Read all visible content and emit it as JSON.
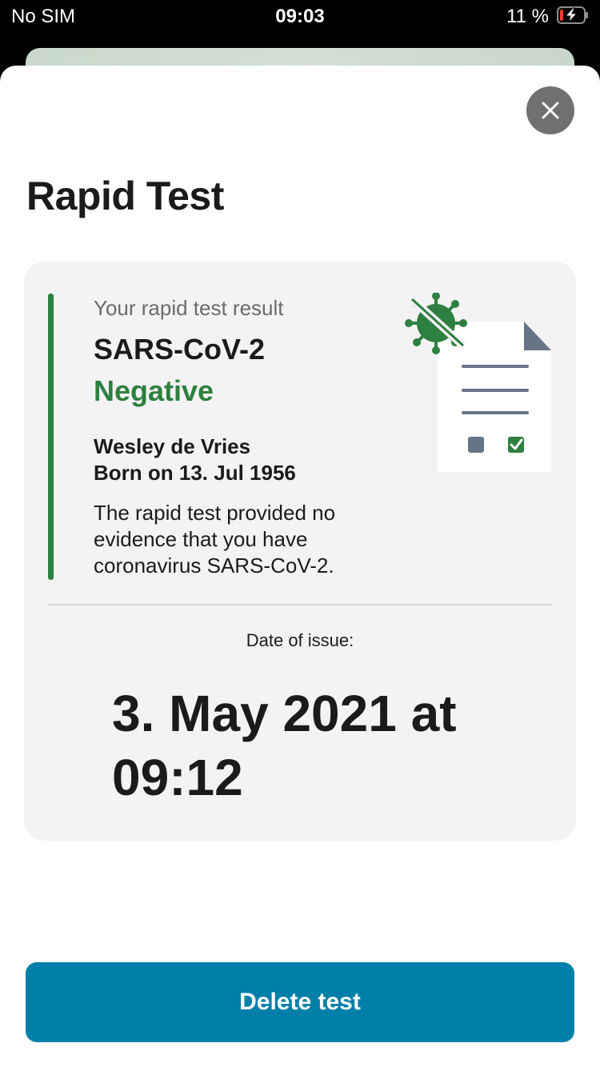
{
  "status_bar": {
    "carrier": "No SIM",
    "time": "09:03",
    "battery": "11 %",
    "battery_level": 0.11
  },
  "sheet": {
    "title": "Rapid Test",
    "close_icon": "close-icon"
  },
  "certificate": {
    "subtitle": "Your rapid test result",
    "pathogen": "SARS-CoV-2",
    "result": "Negative",
    "name": "Wesley de Vries",
    "birth": "Born on 13. Jul 1956",
    "description": "The rapid test provided no evidence that you have coronavirus SARS-CoV-2.",
    "issue_label": "Date of issue:",
    "issue_date": "3. May 2021 at 09:12",
    "illustration_icon": "virus-document-icon"
  },
  "actions": {
    "delete_label": "Delete test"
  },
  "colors": {
    "accent_green": "#2e8040",
    "button_blue": "#007faa",
    "card_bg": "#f3f3f3"
  }
}
